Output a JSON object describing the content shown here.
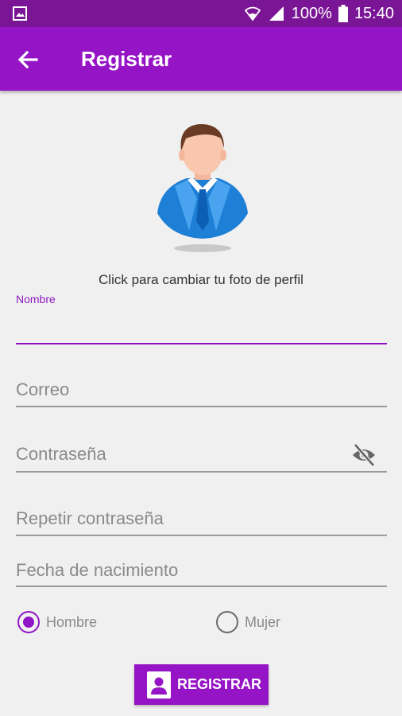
{
  "status_bar": {
    "battery_percent": "100%",
    "time": "15:40",
    "icons": [
      "image-icon",
      "wifi-icon",
      "signal-icon",
      "battery-icon"
    ]
  },
  "app_bar": {
    "title": "Registrar",
    "back_icon": "arrow-left-icon"
  },
  "profile": {
    "caption": "Click para cambiar tu foto de perfil",
    "avatar_icon": "user-avatar-icon"
  },
  "form": {
    "nombre": {
      "label": "Nombre",
      "value": ""
    },
    "correo": {
      "placeholder": "Correo"
    },
    "contrasena": {
      "placeholder": "Contraseña",
      "toggle_icon": "eye-off-icon"
    },
    "repetir": {
      "placeholder": "Repetir contraseña"
    },
    "fecha": {
      "placeholder": "Fecha de nacimiento"
    },
    "gender": {
      "options": [
        {
          "label": "Hombre",
          "checked": true
        },
        {
          "label": "Mujer",
          "checked": false
        }
      ]
    }
  },
  "register_button": {
    "label": "REGISTRAR",
    "icon": "contact-icon"
  },
  "colors": {
    "status_bar": "#7a1596",
    "app_bar": "#9515c6",
    "accent": "#9010c4",
    "background": "#f0f0f0"
  }
}
